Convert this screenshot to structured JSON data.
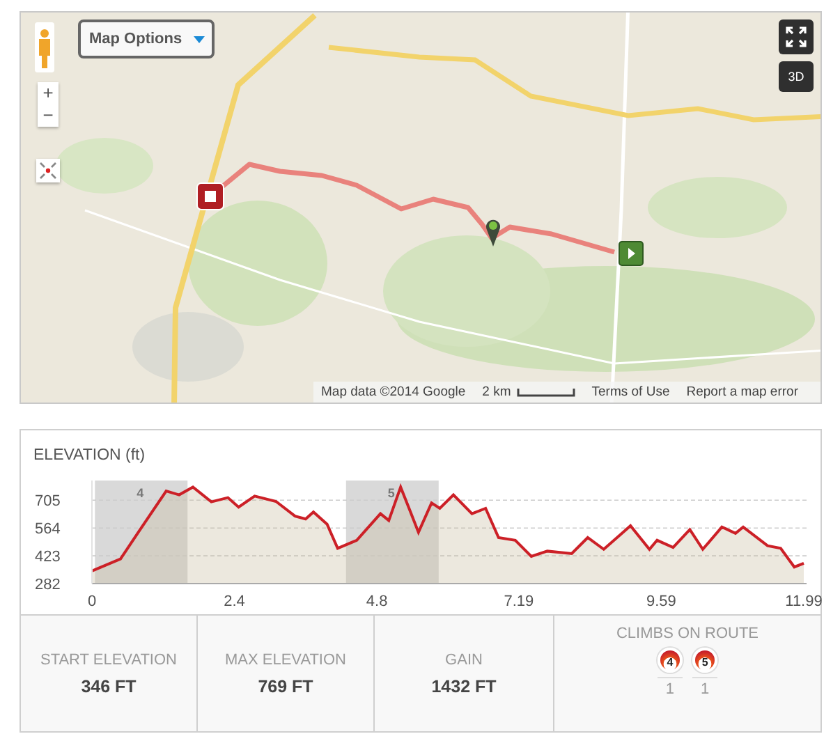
{
  "map": {
    "options_button": "Map Options",
    "zoom_in": "+",
    "zoom_out": "−",
    "three_d_button": "3D",
    "attribution": "Map data ©2014 Google",
    "scale": "2 km",
    "terms_link": "Terms of Use",
    "report_link": "Report a map error"
  },
  "elevation": {
    "chart_data": {
      "type": "area",
      "title": "ELEVATION (ft)",
      "xlim": [
        0,
        11.99
      ],
      "ylim": [
        282,
        805
      ],
      "xticks": [
        0,
        2.4,
        4.8,
        7.19,
        9.59,
        11.99
      ],
      "yticks": [
        282,
        423,
        564,
        705
      ],
      "x": [
        0,
        0.48,
        0.84,
        1.25,
        1.47,
        1.7,
        2.01,
        2.29,
        2.47,
        2.74,
        3.1,
        3.42,
        3.6,
        3.73,
        3.96,
        4.14,
        4.46,
        4.86,
        5.0,
        5.2,
        5.36,
        5.5,
        5.72,
        5.86,
        6.09,
        6.4,
        6.63,
        6.85,
        7.13,
        7.4,
        7.67,
        8.08,
        8.35,
        8.62,
        9.07,
        9.39,
        9.52,
        9.79,
        10.07,
        10.29,
        10.61,
        10.84,
        10.97,
        11.38,
        11.6,
        11.83,
        11.99
      ],
      "series": [
        {
          "color": "#cc2027",
          "values": [
            346,
            407,
            569,
            751,
            732,
            772,
            697,
            718,
            670,
            726,
            699,
            624,
            610,
            645,
            583,
            461,
            502,
            637,
            602,
            772,
            650,
            542,
            691,
            664,
            732,
            637,
            664,
            515,
            502,
            420,
            447,
            434,
            515,
            456,
            575,
            456,
            502,
            466,
            556,
            456,
            569,
            537,
            569,
            474,
            461,
            366,
            385
          ]
        }
      ],
      "grid": true,
      "bands": [
        {
          "axis": "x",
          "from": 0.05,
          "to": 1.61,
          "label": "4"
        },
        {
          "axis": "x",
          "from": 4.28,
          "to": 5.84,
          "label": "5"
        }
      ]
    }
  },
  "stats": [
    {
      "label": "START ELEVATION",
      "value": "346 FT"
    },
    {
      "label": "MAX ELEVATION",
      "value": "769 FT"
    },
    {
      "label": "GAIN",
      "value": "1432 FT"
    }
  ],
  "climbs": {
    "label": "CLIMBS ON ROUTE",
    "items": [
      {
        "category": "4",
        "count": "1"
      },
      {
        "category": "5",
        "count": "1"
      }
    ]
  }
}
